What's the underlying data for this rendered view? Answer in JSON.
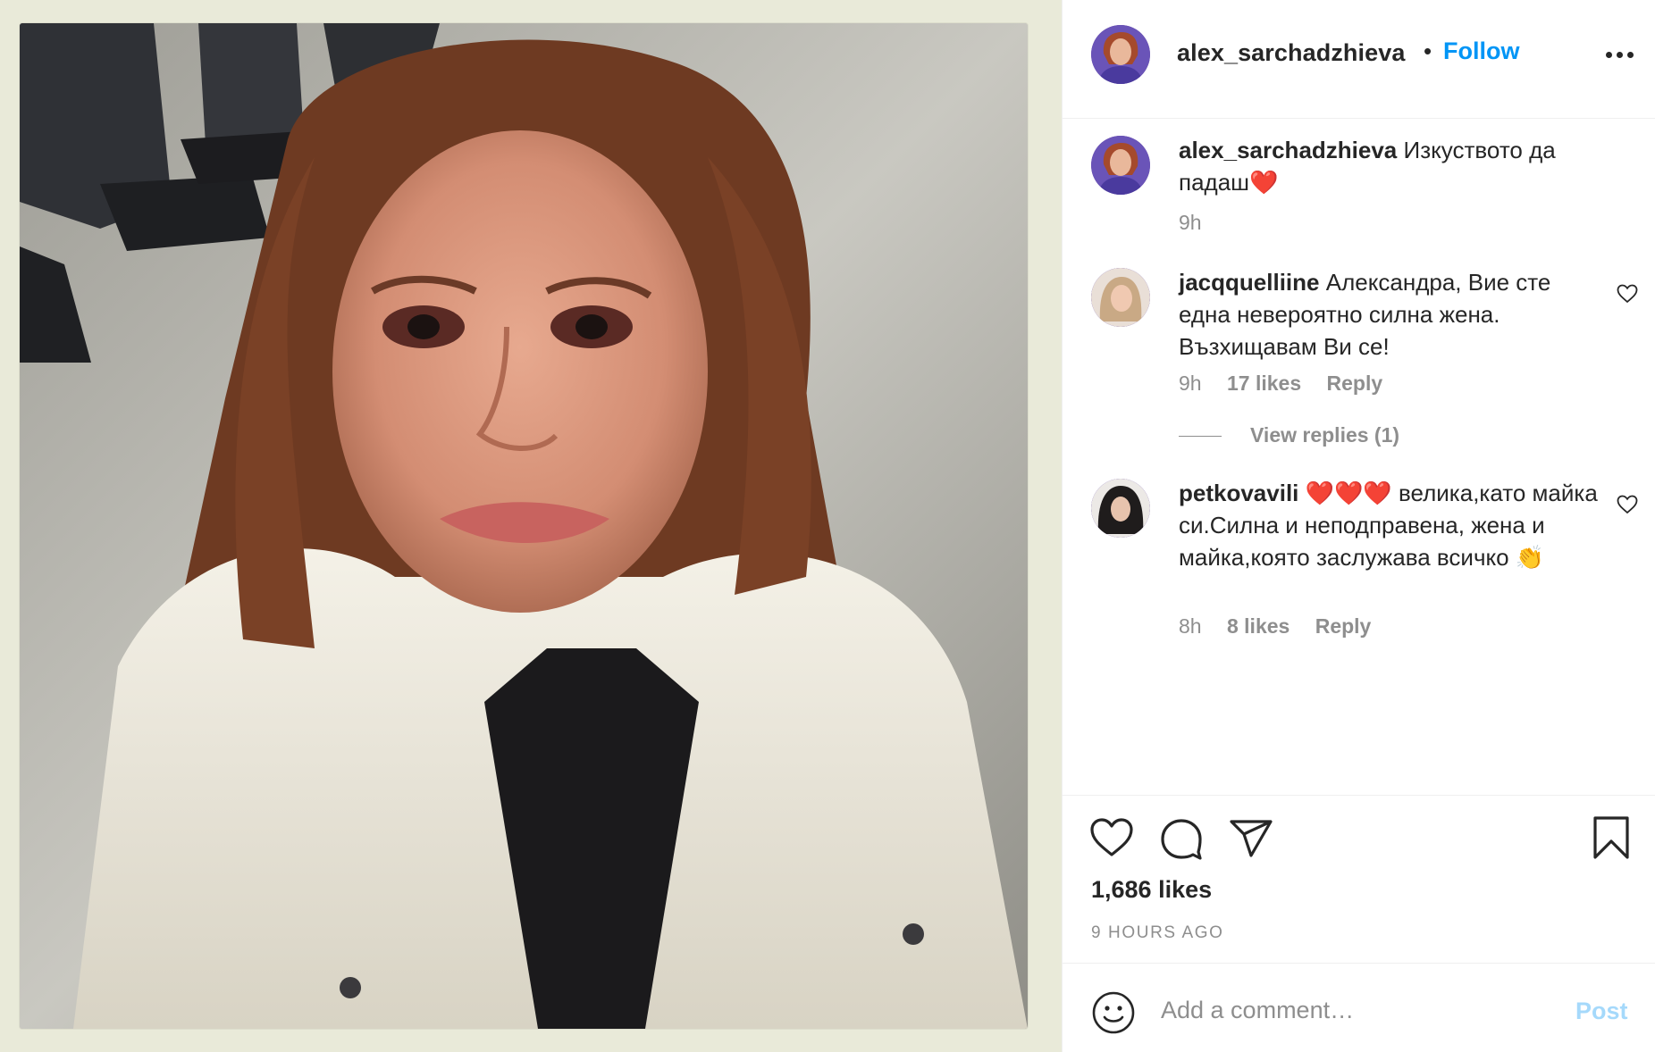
{
  "post": {
    "username": "alex_sarchadzhieva",
    "separator": "•",
    "follow_label": "Follow",
    "photo_alt": "Photo by alex_sarchadzhieva"
  },
  "caption": {
    "username": "alex_sarchadzhieva",
    "text": "Изкуството да падаш❤️",
    "time": "9h"
  },
  "comments": [
    {
      "username": "jacqquelliine",
      "text": "Александра, Вие сте една невероятно силна жена. Възхищавам Ви се!",
      "time": "9h",
      "likes": "17 likes",
      "reply_label": "Reply",
      "view_replies": "View replies (1)"
    },
    {
      "username": "petkovavili",
      "text": "❤️❤️❤️ велика,като майка си.Силна и неподправена, жена и майка,която заслужава всичко 👏",
      "time": "8h",
      "likes": "8 likes",
      "reply_label": "Reply"
    }
  ],
  "stats": {
    "likes": "1,686 likes",
    "posted": "9 HOURS AGO"
  },
  "composer": {
    "placeholder": "Add a comment…",
    "post_label": "Post"
  },
  "colors": {
    "accent": "#0095f6",
    "text": "#262626",
    "muted": "#8e8e8e",
    "divider": "#efefef"
  },
  "icons": [
    "more-options-icon",
    "heart-icon",
    "comment-icon",
    "share-icon",
    "bookmark-icon",
    "emoji-icon"
  ]
}
